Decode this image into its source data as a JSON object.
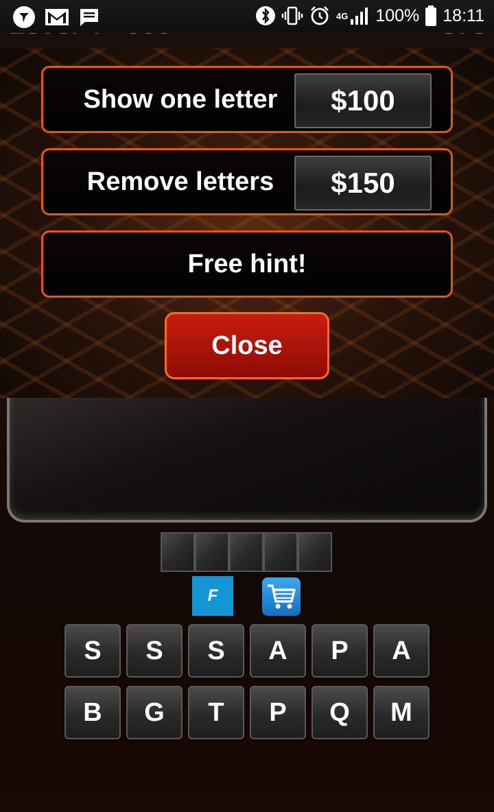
{
  "status_bar": {
    "battery_text": "100%",
    "time": "18:11",
    "network_label": "4G",
    "icons": [
      "telegram-icon",
      "gmail-icon",
      "message-icon",
      "bluetooth-icon",
      "vibrate-icon",
      "alarm-icon",
      "signal-icon",
      "battery-icon"
    ]
  },
  "game_header": {
    "level_text": "Level 4 - 500",
    "coins_text": "375"
  },
  "hint_menu": {
    "show_letter": {
      "label": "Show one letter",
      "price": "$100"
    },
    "remove_letters": {
      "label": "Remove letters",
      "price": "$150"
    },
    "free_hint": {
      "label": "Free hint!"
    },
    "close_label": "Close"
  },
  "toolbar": {
    "facebook_label": "F"
  },
  "keyboard": {
    "row1": [
      "S",
      "S",
      "S",
      "A",
      "P",
      "A"
    ],
    "row2": [
      "B",
      "G",
      "T",
      "P",
      "Q",
      "M"
    ]
  },
  "colors": {
    "accent_border": "#e15a14",
    "close_button": "#b01408",
    "facebook_blue": "#1596d4",
    "cart_blue": "#1a84d4"
  }
}
